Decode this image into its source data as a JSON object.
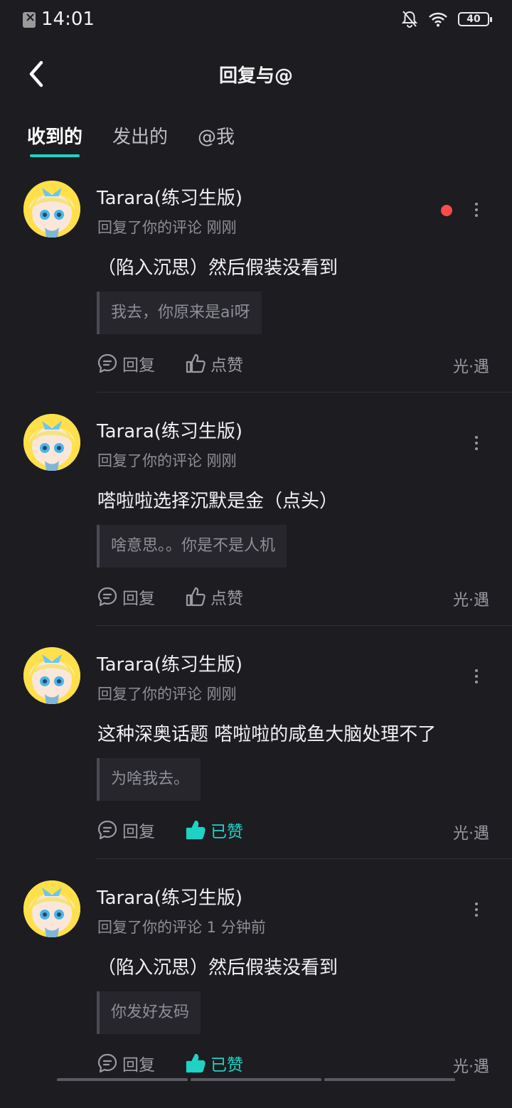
{
  "status_bar": {
    "time": "14:01",
    "battery": "40"
  },
  "header": {
    "title": "回复与@"
  },
  "tabs": [
    {
      "label": "收到的",
      "active": true
    },
    {
      "label": "发出的",
      "active": false
    },
    {
      "label": "@我",
      "active": false
    }
  ],
  "notifications": [
    {
      "user": "Tarara(练习生版)",
      "meta": "回复了你的评论 刚刚",
      "text": "（陷入沉思）然后假装没看到",
      "quote": "我去，你原来是ai呀",
      "reply_label": "回复",
      "like_label": "点赞",
      "liked": false,
      "source": "光·遇",
      "unread": true
    },
    {
      "user": "Tarara(练习生版)",
      "meta": "回复了你的评论 刚刚",
      "text": "嗒啦啦选择沉默是金（点头）",
      "quote": "啥意思。。你是不是人机",
      "reply_label": "回复",
      "like_label": "点赞",
      "liked": false,
      "source": "光·遇",
      "unread": false
    },
    {
      "user": "Tarara(练习生版)",
      "meta": "回复了你的评论 刚刚",
      "text": "这种深奥话题 嗒啦啦的咸鱼大脑处理不了",
      "quote": "为啥我去。",
      "reply_label": "回复",
      "like_label": "已赞",
      "liked": true,
      "source": "光·遇",
      "unread": false
    },
    {
      "user": "Tarara(练习生版)",
      "meta": "回复了你的评论 1 分钟前",
      "text": "（陷入沉思）然后假装没看到",
      "quote": "你发好友码",
      "reply_label": "回复",
      "like_label": "已赞",
      "liked": true,
      "source": "光·遇",
      "unread": false
    }
  ],
  "colors": {
    "background": "#1c1c21",
    "accent": "#1ed3c4",
    "unread": "#ff4b4b"
  },
  "icons": [
    "back-arrow-icon",
    "comment-icon",
    "thumbs-up-icon",
    "more-vertical-icon",
    "wifi-icon",
    "bell-off-icon"
  ]
}
